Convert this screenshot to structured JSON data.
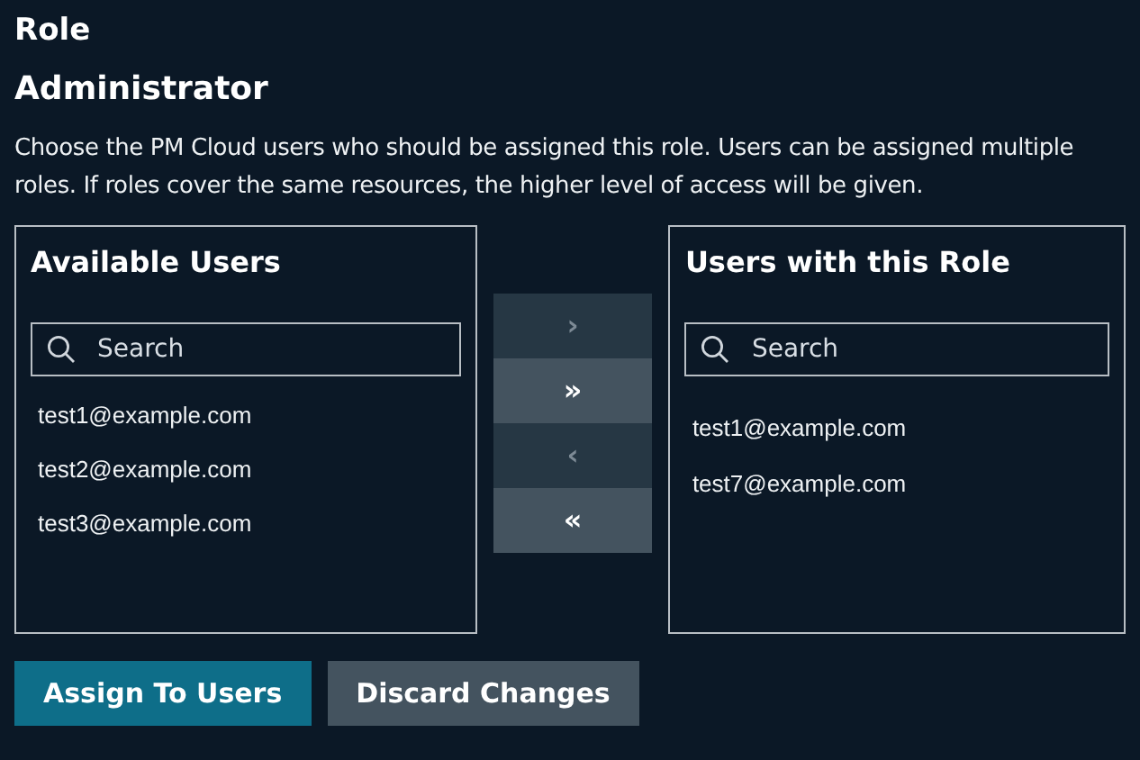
{
  "title": "Role",
  "role_name": "Administrator",
  "description": "Choose the PM Cloud users who should be assigned this role. Users can be assigned multiple roles. If roles cover the same resources, the higher level of access will be given.",
  "available_users": {
    "heading": "Available Users",
    "search": {
      "placeholder": "Search"
    },
    "items": [
      "test1@example.com",
      "test2@example.com",
      "test3@example.com"
    ]
  },
  "transfer_buttons": [
    {
      "label": "›",
      "disabled": true
    },
    {
      "label": "»",
      "disabled": false
    },
    {
      "label": "‹",
      "disabled": true
    },
    {
      "label": "«",
      "disabled": false
    }
  ],
  "assigned_users": {
    "heading": "Users with this Role",
    "search": {
      "placeholder": "Search"
    },
    "items": [
      "test1@example.com",
      "test7@example.com"
    ]
  },
  "buttons": [
    {
      "label": "Assign To Users",
      "kind": "primary"
    },
    {
      "label": "Discard Changes",
      "kind": "secondary"
    }
  ]
}
